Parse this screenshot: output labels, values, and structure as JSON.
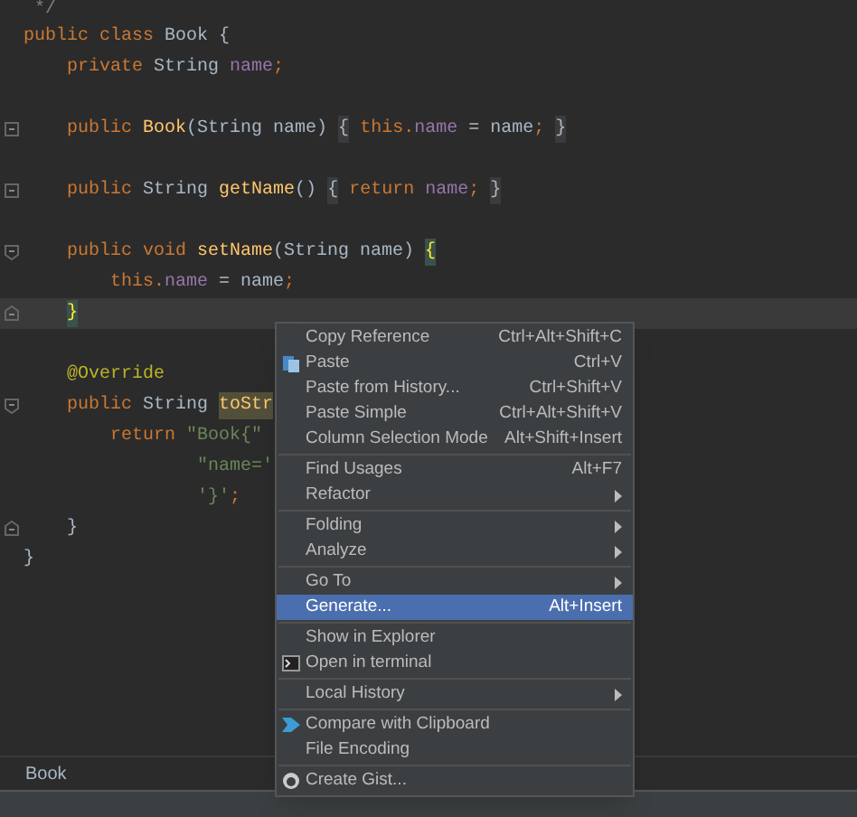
{
  "editor": {
    "lines": [
      {
        "kind": "plain",
        "current": false,
        "tokens": [
          {
            "text": "*/",
            "kind": "comment"
          }
        ]
      },
      {
        "kind": "plain",
        "current": false,
        "tokens": [
          {
            "text": "public class ",
            "kind": "keyword"
          },
          {
            "text": "Book",
            "kind": "plain"
          },
          {
            "text": " {",
            "kind": "plain"
          }
        ]
      },
      {
        "kind": "plain",
        "current": false,
        "tokens": [
          {
            "text": "private ",
            "kind": "keyword"
          },
          {
            "text": "String ",
            "kind": "plain"
          },
          {
            "text": "name",
            "kind": "field"
          },
          {
            "text": ";",
            "kind": "keyword"
          }
        ]
      },
      {
        "kind": "blank",
        "current": false
      },
      {
        "kind": "folded",
        "current": false,
        "tokens": [
          {
            "text": "public ",
            "kind": "keyword"
          },
          {
            "text": "Book",
            "kind": "method"
          },
          {
            "text": "(String name) ",
            "kind": "plain"
          },
          {
            "text": "{",
            "kind": "folded"
          },
          {
            "text": " this.",
            "kind": "keyword"
          },
          {
            "text": "name",
            "kind": "field"
          },
          {
            "text": " = name",
            "kind": "plain"
          },
          {
            "text": "; ",
            "kind": "keyword"
          },
          {
            "text": "}",
            "kind": "folded"
          }
        ]
      },
      {
        "kind": "blank",
        "current": false
      },
      {
        "kind": "folded",
        "current": false,
        "tokens": [
          {
            "text": "public ",
            "kind": "keyword"
          },
          {
            "text": "String ",
            "kind": "plain"
          },
          {
            "text": "getName",
            "kind": "method"
          },
          {
            "text": "() ",
            "kind": "plain"
          },
          {
            "text": "{",
            "kind": "folded"
          },
          {
            "text": " return ",
            "kind": "keyword"
          },
          {
            "text": "name",
            "kind": "field"
          },
          {
            "text": "; ",
            "kind": "keyword"
          },
          {
            "text": "}",
            "kind": "folded"
          }
        ]
      },
      {
        "kind": "blank",
        "current": false
      },
      {
        "kind": "fold_start",
        "current": false,
        "tokens": [
          {
            "text": "public void ",
            "kind": "keyword"
          },
          {
            "text": "setName",
            "kind": "method"
          },
          {
            "text": "(String name) ",
            "kind": "plain"
          },
          {
            "text": "{",
            "kind": "brace"
          }
        ]
      },
      {
        "kind": "plain",
        "current": false,
        "tokens": [
          {
            "text": "this.",
            "kind": "keyword"
          },
          {
            "text": "name",
            "kind": "field"
          },
          {
            "text": " = name",
            "kind": "plain"
          },
          {
            "text": ";",
            "kind": "keyword"
          }
        ]
      },
      {
        "kind": "fold_end",
        "current": true,
        "tokens": [
          {
            "text": "}",
            "kind": "brace"
          }
        ]
      },
      {
        "kind": "blank",
        "current": false
      },
      {
        "kind": "plain",
        "current": false,
        "tokens": [
          {
            "text": "@Override",
            "kind": "annotation"
          }
        ]
      },
      {
        "kind": "fold_start",
        "current": false,
        "tokens": [
          {
            "text": "public ",
            "kind": "keyword"
          },
          {
            "text": "String ",
            "kind": "plain"
          },
          {
            "text": "toStr",
            "kind": "highlight"
          }
        ]
      },
      {
        "kind": "plain",
        "current": false,
        "tokens": [
          {
            "text": "return ",
            "kind": "keyword"
          },
          {
            "text": "\"Book{\"",
            "kind": "string"
          }
        ]
      },
      {
        "kind": "plain",
        "current": false,
        "tokens": [
          {
            "text": "\"name='",
            "kind": "string"
          }
        ]
      },
      {
        "kind": "plain",
        "current": false,
        "tokens": [
          {
            "text": "'}'",
            "kind": "string"
          },
          {
            "text": ";",
            "kind": "keyword"
          }
        ]
      },
      {
        "kind": "fold_end",
        "current": false,
        "tokens": [
          {
            "text": "}",
            "kind": "plain"
          }
        ]
      },
      {
        "kind": "plain",
        "current": false,
        "tokens": [
          {
            "text": "}",
            "kind": "plain"
          }
        ]
      }
    ]
  },
  "context_menu": {
    "items": [
      {
        "kind": "item",
        "label": "Copy Reference",
        "shortcut": "Ctrl+Alt+Shift+C",
        "selected": false
      },
      {
        "kind": "item",
        "label": "Paste",
        "shortcut": "Ctrl+V",
        "selected": false
      },
      {
        "kind": "item",
        "label": "Paste from History...",
        "shortcut": "Ctrl+Shift+V",
        "selected": false
      },
      {
        "kind": "item",
        "label": "Paste Simple",
        "shortcut": "Ctrl+Alt+Shift+V",
        "selected": false
      },
      {
        "kind": "item",
        "label": "Column Selection Mode",
        "shortcut": "Alt+Shift+Insert",
        "selected": false
      },
      {
        "kind": "separator"
      },
      {
        "kind": "item",
        "label": "Find Usages",
        "shortcut": "Alt+F7",
        "selected": false
      },
      {
        "kind": "submenu",
        "label": "Refactor",
        "selected": false
      },
      {
        "kind": "separator"
      },
      {
        "kind": "submenu",
        "label": "Folding",
        "selected": false
      },
      {
        "kind": "submenu",
        "label": "Analyze",
        "selected": false
      },
      {
        "kind": "separator"
      },
      {
        "kind": "submenu",
        "label": "Go To",
        "selected": false
      },
      {
        "kind": "item",
        "label": "Generate...",
        "shortcut": "Alt+Insert",
        "selected": true
      },
      {
        "kind": "separator"
      },
      {
        "kind": "item",
        "label": "Show in Explorer",
        "selected": false
      },
      {
        "kind": "item",
        "label": "Open in terminal",
        "selected": false
      },
      {
        "kind": "separator"
      },
      {
        "kind": "submenu",
        "label": "Local History",
        "selected": false
      },
      {
        "kind": "separator"
      },
      {
        "kind": "item",
        "label": "Compare with Clipboard",
        "selected": false
      },
      {
        "kind": "item",
        "label": "File Encoding",
        "selected": false
      },
      {
        "kind": "separator"
      },
      {
        "kind": "item",
        "label": "Create Gist...",
        "selected": false
      }
    ]
  },
  "breadcrumb": {
    "label": "Book"
  }
}
